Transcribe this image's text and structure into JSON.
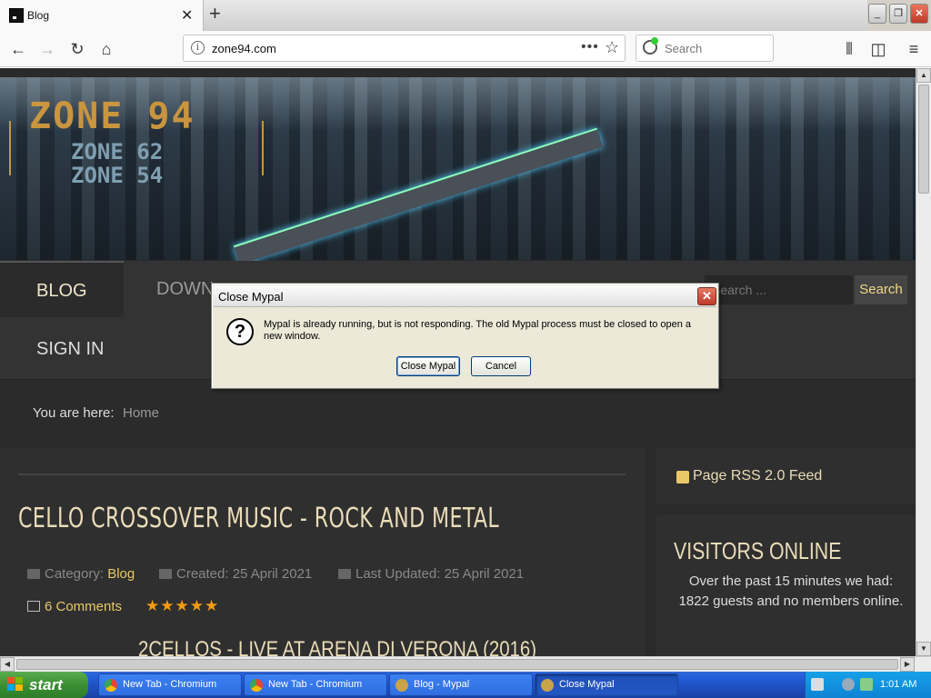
{
  "browser": {
    "tab_title": "Blog",
    "new_tab_label": "+",
    "url": "zone94.com",
    "search_placeholder": "Search",
    "page_actions_label": "•••"
  },
  "site": {
    "logo_main": "ZONE 94",
    "logo_sub1": "ZONE 62",
    "logo_sub2": "ZONE 54",
    "menu": [
      "BLOG",
      "DOWN",
      "SIGN IN"
    ],
    "search_placeholder": "Search ...",
    "search_button": "Search",
    "breadcrumb_label": "You are here:",
    "breadcrumb_home": "Home"
  },
  "article": {
    "title": "CELLO CROSSOVER MUSIC - ROCK AND METAL",
    "category_label": "Category:",
    "category_value": "Blog",
    "created": "Created: 25 April 2021",
    "updated": "Last Updated: 25 April 2021",
    "comments": "6 Comments",
    "rating": "★★★★★",
    "subtitle": "2CELLOS - LIVE AT ARENA DI VERONA (2016)"
  },
  "sidebar": {
    "rss": "Page RSS 2.0 Feed",
    "visitors_title": "VISITORS ONLINE",
    "visitors_text": "Over the past 15 minutes we had: 1822 guests and no members online."
  },
  "dialog": {
    "title": "Close Mypal",
    "message": "Mypal is already running, but is not responding. The old Mypal process must be closed to open a new window.",
    "primary_button": "Close Mypal",
    "secondary_button": "Cancel"
  },
  "taskbar": {
    "start_label": "start",
    "tasks": [
      "New Tab - Chromium",
      "New Tab - Chromium",
      "Blog - Mypal",
      "Close Mypal"
    ],
    "clock": "1:01 AM"
  }
}
